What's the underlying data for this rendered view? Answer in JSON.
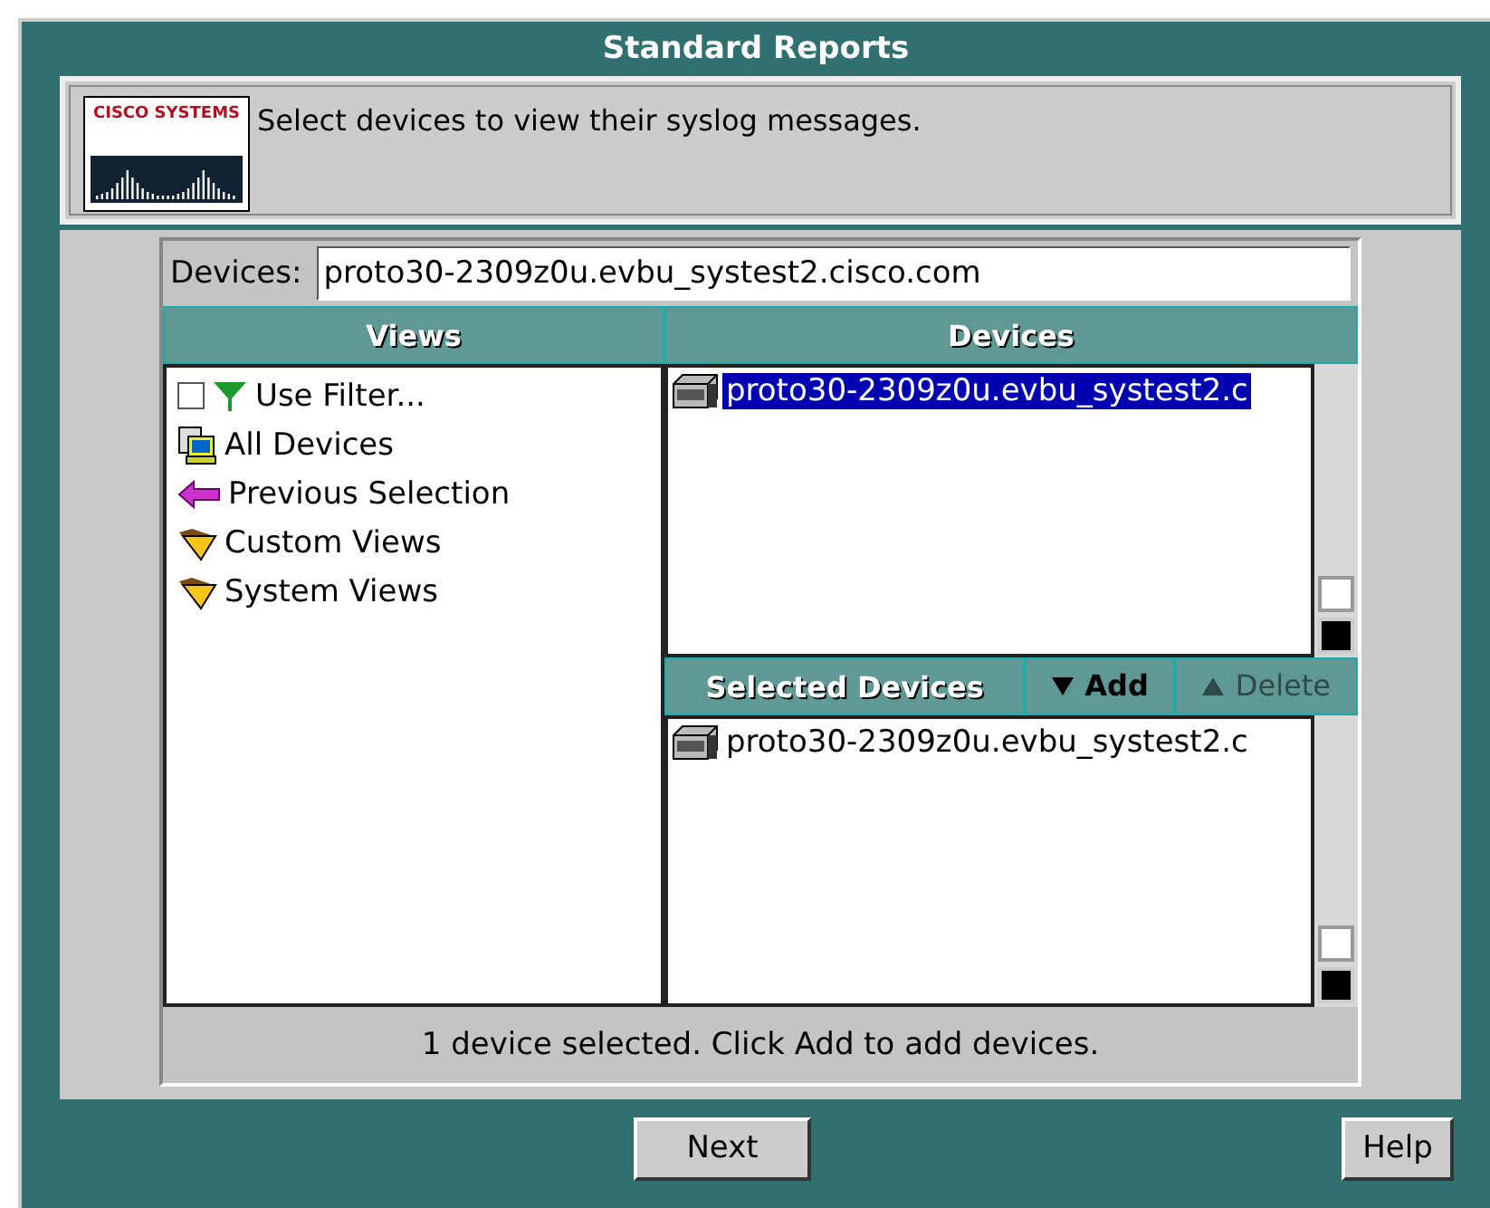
{
  "window": {
    "title": "Standard Reports"
  },
  "header": {
    "logo": "CISCO SYSTEMS",
    "message": "Select devices to view their syslog messages."
  },
  "devices_field": {
    "label": "Devices:",
    "value": "proto30-2309z0u.evbu_systest2.cisco.com"
  },
  "views": {
    "heading": "Views",
    "items": [
      {
        "kind": "filter",
        "label": "Use Filter...",
        "checked": false
      },
      {
        "kind": "devices",
        "label": "All Devices"
      },
      {
        "kind": "previous",
        "label": "Previous Selection"
      },
      {
        "kind": "folder",
        "label": "Custom Views"
      },
      {
        "kind": "folder",
        "label": "System Views"
      }
    ]
  },
  "devices": {
    "heading": "Devices",
    "items": [
      {
        "label": "proto30-2309z0u.evbu_systest2.c",
        "selected": true
      }
    ]
  },
  "selected_devices": {
    "heading": "Selected Devices",
    "add": {
      "label": "Add",
      "disabled": false
    },
    "delete": {
      "label": "Delete",
      "disabled": true
    },
    "items": [
      {
        "label": "proto30-2309z0u.evbu_systest2.c",
        "selected": false
      }
    ]
  },
  "status": "1 device selected. Click Add to add devices.",
  "buttons": [
    {
      "kind": "next",
      "label": "Next"
    },
    {
      "kind": "help",
      "label": "Help"
    }
  ]
}
